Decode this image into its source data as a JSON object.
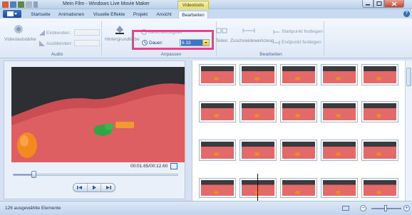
{
  "window": {
    "title": "Mein Film - Windows Live Movie Maker",
    "context_tab": "Videotools"
  },
  "tabs": [
    "Startseite",
    "Animationen",
    "Visuelle Effekte",
    "Projekt",
    "Ansicht",
    "Bearbeiten"
  ],
  "ribbon": {
    "audio": {
      "volume_label": "Videolautstärke",
      "fade_in_label": "Einblenden:",
      "fade_out_label": "Ausblenden:",
      "group_label": "Audio"
    },
    "adjust": {
      "bg_color_label": "Hintergrundfarbe",
      "speed_label": "Geschwindigkeit",
      "duration_label": "Dauer:",
      "duration_value": "6.33",
      "group_label": "Anpassen"
    },
    "edit": {
      "split_label": "Teilen",
      "trim_label": "Zuschneidewerkzeug",
      "start_label": "Startpunkt festlegen",
      "end_label": "Endpunkt festlegen",
      "group_label": "Bearbeiten"
    }
  },
  "preview": {
    "timecode": "00:01.65/00:12.60",
    "seek_fraction": 0.13
  },
  "status": {
    "selection": "126 ausgewählte Elemente"
  },
  "colors": {
    "highlight": "#ee3f8c",
    "accent": "#3d74c4",
    "clay_red": "#e46a6a"
  }
}
